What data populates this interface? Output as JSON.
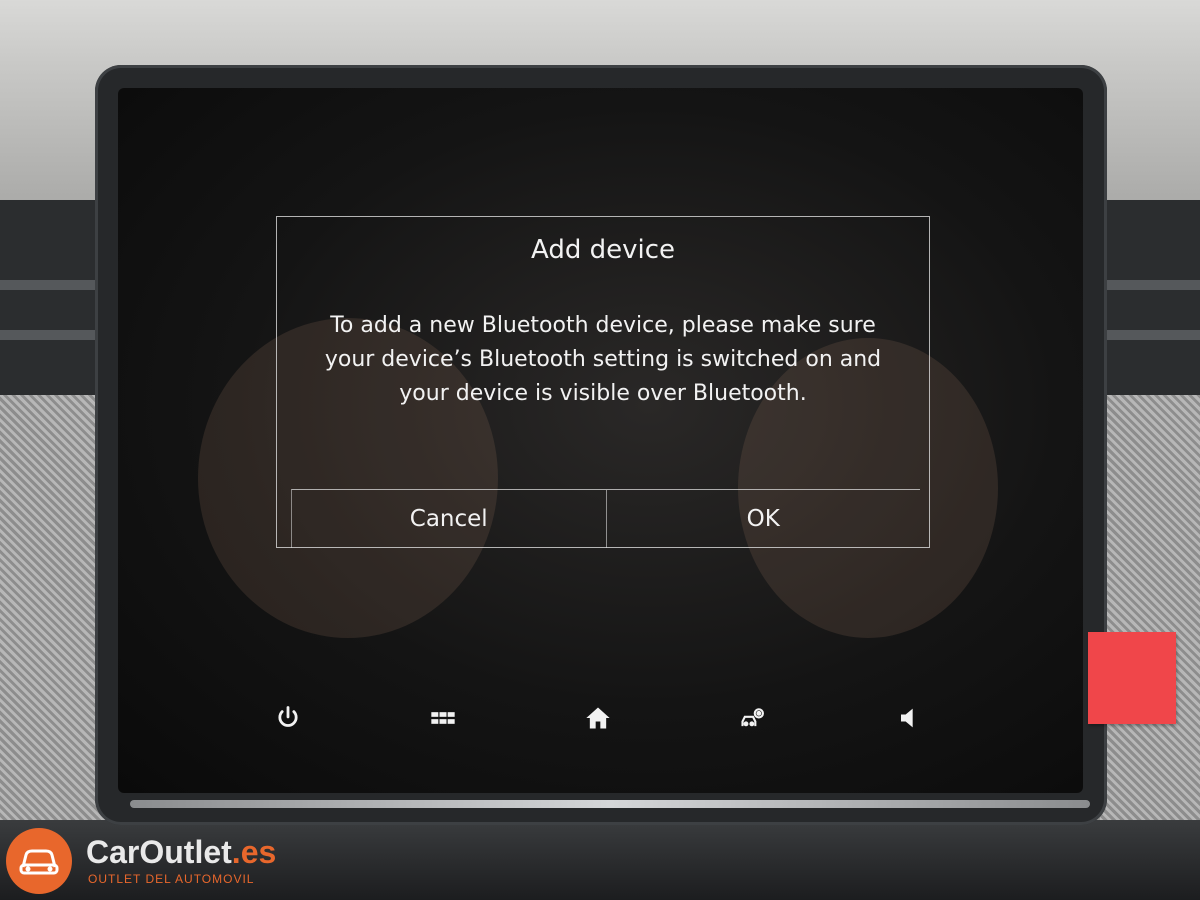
{
  "dialog": {
    "title": "Add device",
    "message": "To add a new Bluetooth device, please make sure your device’s Bluetooth setting is switched on and your device is visible over Bluetooth.",
    "cancel_label": "Cancel",
    "ok_label": "OK"
  },
  "navbar": {
    "icons": [
      "power-icon",
      "apps-grid-icon",
      "home-icon",
      "vehicle-settings-icon",
      "volume-icon"
    ]
  },
  "watermark": {
    "brand_main": "CarOutlet",
    "brand_suffix": ".es",
    "tagline": "OUTLET DEL AUTOMOVIL"
  },
  "colors": {
    "text": "#f2f2f2",
    "brand": "#e8672c",
    "sticker": "#f0464a"
  }
}
